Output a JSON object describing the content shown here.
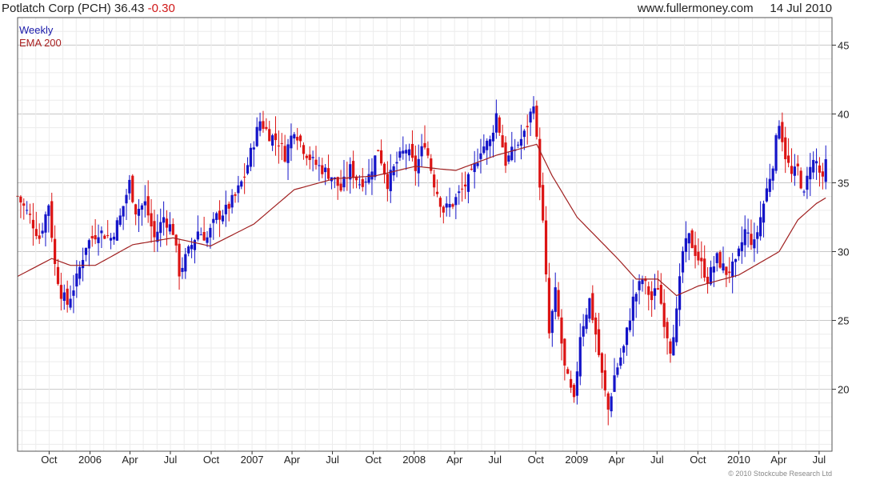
{
  "header": {
    "title": "Potlatch Corp (PCH) 36.43",
    "change": "-0.30",
    "site": "www.fullermoney.com",
    "date": "14 Jul 2010"
  },
  "legend": {
    "series1": "Weekly",
    "series2": "EMA 200"
  },
  "copyright": "© 2010 Stockcube Research Ltd",
  "colors": {
    "up": "#1414c8",
    "down": "#dc1414",
    "ema": "#a02020",
    "grid": "#dcdcdc",
    "axis": "#333333"
  },
  "chart_data": {
    "type": "candlestick",
    "frequency": "weekly",
    "ylim": [
      15.5,
      47
    ],
    "y_ticks": [
      20,
      25,
      30,
      35,
      40,
      45
    ],
    "x_tick_labels": [
      "Oct",
      "2006",
      "Apr",
      "Jul",
      "Oct",
      "2007",
      "Apr",
      "Jul",
      "Oct",
      "2008",
      "Apr",
      "Jul",
      "Oct",
      "2009",
      "Apr",
      "Jul",
      "Oct",
      "2010",
      "Apr",
      "Jul"
    ],
    "x_tick_dates": [
      "2005-10-01",
      "2006-01-01",
      "2006-04-01",
      "2006-07-01",
      "2006-10-01",
      "2007-01-01",
      "2007-04-01",
      "2007-07-01",
      "2007-10-01",
      "2008-01-01",
      "2008-04-01",
      "2008-07-01",
      "2008-10-01",
      "2009-01-01",
      "2009-04-01",
      "2009-07-01",
      "2009-10-01",
      "2010-01-01",
      "2010-04-01",
      "2010-07-01"
    ],
    "date_range": [
      "2005-07-22",
      "2010-07-30"
    ],
    "close_anchors": [
      [
        "2005-07-22",
        34.0
      ],
      [
        "2005-08-19",
        32.5
      ],
      [
        "2005-09-09",
        31.0
      ],
      [
        "2005-09-30",
        33.5
      ],
      [
        "2005-10-14",
        29.0
      ],
      [
        "2005-10-28",
        27.0
      ],
      [
        "2005-11-11",
        26.2
      ],
      [
        "2005-12-02",
        28.0
      ],
      [
        "2005-12-23",
        30.5
      ],
      [
        "2006-01-20",
        31.5
      ],
      [
        "2006-02-17",
        31.0
      ],
      [
        "2006-03-10",
        32.5
      ],
      [
        "2006-03-31",
        35.0
      ],
      [
        "2006-04-14",
        33.0
      ],
      [
        "2006-05-05",
        33.5
      ],
      [
        "2006-05-26",
        31.0
      ],
      [
        "2006-06-16",
        32.5
      ],
      [
        "2006-07-07",
        31.5
      ],
      [
        "2006-07-21",
        28.5
      ],
      [
        "2006-08-11",
        30.0
      ],
      [
        "2006-09-01",
        31.5
      ],
      [
        "2006-09-22",
        31.0
      ],
      [
        "2006-10-13",
        32.5
      ],
      [
        "2006-11-03",
        33.0
      ],
      [
        "2006-11-24",
        34.0
      ],
      [
        "2006-12-15",
        35.5
      ],
      [
        "2007-01-05",
        38.0
      ],
      [
        "2007-01-19",
        39.5
      ],
      [
        "2007-02-09",
        38.5
      ],
      [
        "2007-03-02",
        38.0
      ],
      [
        "2007-03-16",
        37.0
      ],
      [
        "2007-04-06",
        39.0
      ],
      [
        "2007-04-27",
        37.5
      ],
      [
        "2007-05-18",
        36.5
      ],
      [
        "2007-06-08",
        36.0
      ],
      [
        "2007-06-29",
        35.5
      ],
      [
        "2007-07-20",
        34.5
      ],
      [
        "2007-08-10",
        36.0
      ],
      [
        "2007-08-31",
        35.0
      ],
      [
        "2007-09-21",
        35.5
      ],
      [
        "2007-10-12",
        37.5
      ],
      [
        "2007-11-02",
        35.0
      ],
      [
        "2007-11-23",
        36.5
      ],
      [
        "2007-12-14",
        37.5
      ],
      [
        "2008-01-04",
        36.0
      ],
      [
        "2008-01-25",
        38.0
      ],
      [
        "2008-02-15",
        35.0
      ],
      [
        "2008-03-07",
        33.0
      ],
      [
        "2008-03-28",
        33.5
      ],
      [
        "2008-04-18",
        34.5
      ],
      [
        "2008-05-09",
        35.5
      ],
      [
        "2008-05-30",
        37.5
      ],
      [
        "2008-06-20",
        38.0
      ],
      [
        "2008-07-04",
        40.0
      ],
      [
        "2008-07-25",
        36.5
      ],
      [
        "2008-08-15",
        37.5
      ],
      [
        "2008-09-05",
        38.5
      ],
      [
        "2008-09-19",
        40.0
      ],
      [
        "2008-09-26",
        41.0
      ],
      [
        "2008-10-03",
        38.0
      ],
      [
        "2008-10-10",
        35.0
      ],
      [
        "2008-10-17",
        32.0
      ],
      [
        "2008-10-31",
        24.0
      ],
      [
        "2008-11-14",
        27.0
      ],
      [
        "2008-12-05",
        21.5
      ],
      [
        "2008-12-26",
        19.0
      ],
      [
        "2009-01-09",
        24.0
      ],
      [
        "2009-01-30",
        26.5
      ],
      [
        "2009-02-13",
        24.0
      ],
      [
        "2009-02-27",
        21.0
      ],
      [
        "2009-03-13",
        18.5
      ],
      [
        "2009-03-27",
        21.0
      ],
      [
        "2009-04-17",
        23.0
      ],
      [
        "2009-05-08",
        26.5
      ],
      [
        "2009-05-29",
        28.0
      ],
      [
        "2009-06-19",
        26.5
      ],
      [
        "2009-07-03",
        27.5
      ],
      [
        "2009-07-17",
        25.0
      ],
      [
        "2009-07-31",
        23.0
      ],
      [
        "2009-08-14",
        25.5
      ],
      [
        "2009-08-28",
        30.0
      ],
      [
        "2009-09-11",
        31.0
      ],
      [
        "2009-10-02",
        29.5
      ],
      [
        "2009-10-23",
        28.0
      ],
      [
        "2009-11-13",
        29.5
      ],
      [
        "2009-12-04",
        28.5
      ],
      [
        "2009-12-25",
        29.0
      ],
      [
        "2010-01-15",
        31.5
      ],
      [
        "2010-02-05",
        30.5
      ],
      [
        "2010-02-19",
        32.5
      ],
      [
        "2010-03-05",
        34.5
      ],
      [
        "2010-03-19",
        36.5
      ],
      [
        "2010-04-02",
        39.5
      ],
      [
        "2010-04-16",
        37.0
      ],
      [
        "2010-04-30",
        35.5
      ],
      [
        "2010-05-14",
        36.0
      ],
      [
        "2010-05-28",
        34.0
      ],
      [
        "2010-06-11",
        36.5
      ],
      [
        "2010-06-25",
        36.5
      ],
      [
        "2010-07-09",
        35.0
      ],
      [
        "2010-07-16",
        36.43
      ]
    ],
    "ema_anchors": [
      [
        "2005-07-22",
        28.2
      ],
      [
        "2005-10-07",
        29.5
      ],
      [
        "2005-11-18",
        29.0
      ],
      [
        "2006-01-13",
        29.0
      ],
      [
        "2006-04-07",
        30.5
      ],
      [
        "2006-07-07",
        31.0
      ],
      [
        "2006-09-29",
        30.4
      ],
      [
        "2007-01-05",
        32.0
      ],
      [
        "2007-04-06",
        34.5
      ],
      [
        "2007-07-06",
        35.3
      ],
      [
        "2007-10-05",
        35.5
      ],
      [
        "2008-01-04",
        36.2
      ],
      [
        "2008-02-29",
        36.0
      ],
      [
        "2008-04-04",
        35.9
      ],
      [
        "2008-07-04",
        37.0
      ],
      [
        "2008-10-03",
        37.8
      ],
      [
        "2008-11-07",
        35.5
      ],
      [
        "2009-01-02",
        32.5
      ],
      [
        "2009-04-03",
        29.5
      ],
      [
        "2009-05-15",
        28.0
      ],
      [
        "2009-07-03",
        28.0
      ],
      [
        "2009-08-14",
        26.8
      ],
      [
        "2009-10-02",
        27.5
      ],
      [
        "2010-01-01",
        28.3
      ],
      [
        "2010-04-02",
        30.0
      ],
      [
        "2010-05-14",
        32.3
      ],
      [
        "2010-06-25",
        33.5
      ],
      [
        "2010-07-16",
        33.9
      ]
    ]
  }
}
